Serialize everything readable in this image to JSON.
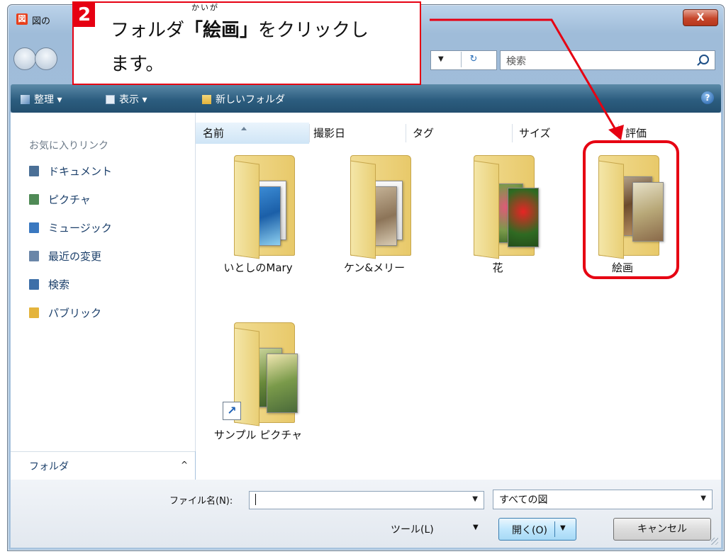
{
  "window": {
    "title": "図の",
    "close_symbol": "X",
    "app_icon_glyph": "図"
  },
  "nav": {
    "search_placeholder": "検索",
    "refresh_glyph": "↻",
    "dropdown_glyph": "▼"
  },
  "toolbar": {
    "organize": "整理 ▾",
    "views": "表示 ▾",
    "new_folder": "新しいフォルダ",
    "help_glyph": "?"
  },
  "sidebar": {
    "title": "お気に入りリンク",
    "items": [
      {
        "label": "ドキュメント",
        "icon": "documents-icon",
        "color": "#4a6f96"
      },
      {
        "label": "ピクチャ",
        "icon": "pictures-icon",
        "color": "#4f8a56"
      },
      {
        "label": "ミュージック",
        "icon": "music-icon",
        "color": "#3a78c0"
      },
      {
        "label": "最近の変更",
        "icon": "recent-icon",
        "color": "#6a86a8"
      },
      {
        "label": "検索",
        "icon": "search-folder-icon",
        "color": "#3d6fa8"
      },
      {
        "label": "パブリック",
        "icon": "public-folder-icon",
        "color": "#e4b43c"
      }
    ],
    "folders_label": "フォルダ",
    "collapse_glyph": "^"
  },
  "columns": [
    "名前",
    "撮影日",
    "タグ",
    "サイズ",
    "評価"
  ],
  "folders": [
    {
      "label": "いとしのMary"
    },
    {
      "label": "ケン&メリー"
    },
    {
      "label": "花"
    },
    {
      "label": "絵画"
    },
    {
      "label": "サンプル ピクチャ",
      "shortcut_glyph": "↗"
    }
  ],
  "bottom": {
    "filename_label": "ファイル名(N):",
    "filename_value": "",
    "filetype_value": "すべての図",
    "tools_label": "ツール(L)",
    "open_label": "開く(O)",
    "cancel_label": "キャンセル"
  },
  "callout": {
    "step": "2",
    "text_before": "フォルダ",
    "bold_text": "「絵画」",
    "text_after": "をクリックし",
    "line2": "ます。",
    "ruby": "かいが"
  },
  "colors": {
    "accent_red": "#e60012",
    "toolbar_blue": "#2c5d7f",
    "folder_yellow": "#e8c96a"
  }
}
